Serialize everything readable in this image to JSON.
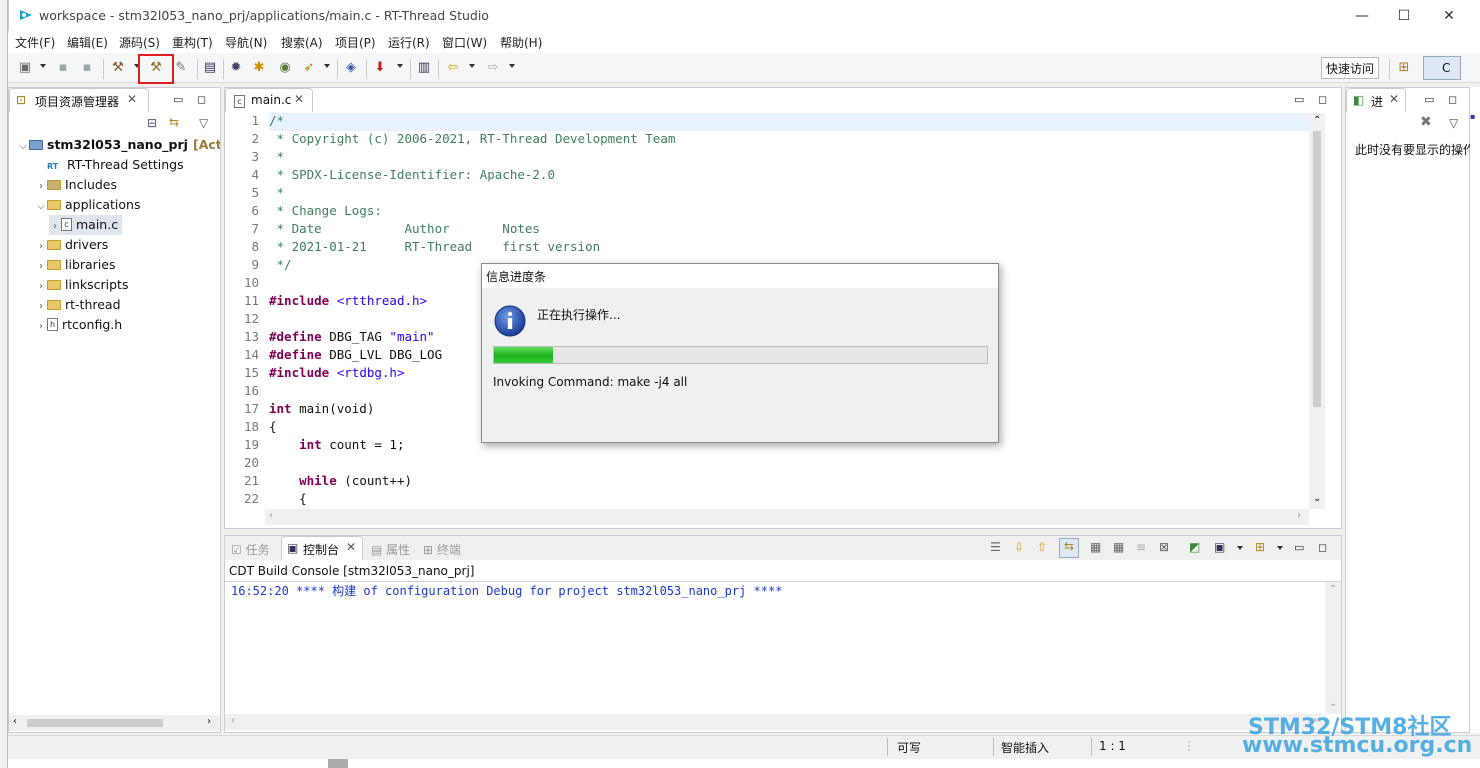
{
  "window": {
    "title": "workspace - stm32l053_nano_prj/applications/main.c - RT-Thread Studio",
    "minimize": "—",
    "maximize": "☐",
    "close": "✕"
  },
  "menu": [
    "文件(F)",
    "编辑(E)",
    "源码(S)",
    "重构(T)",
    "导航(N)",
    "搜索(A)",
    "项目(P)",
    "运行(R)",
    "窗口(W)",
    "帮助(H)"
  ],
  "toolbar": {
    "quick_access": "快速访问",
    "perspective_label": "C",
    "highlight_color": "#e02020"
  },
  "project_explorer": {
    "tab_label": "项目资源管理器",
    "root": "stm32l053_nano_prj",
    "root_badge": "[Act",
    "items": [
      {
        "label": "RT-Thread Settings",
        "icon": "rt-settings-icon"
      },
      {
        "label": "Includes",
        "icon": "includes-icon"
      },
      {
        "label": "applications",
        "icon": "folder-icon"
      },
      {
        "label": "main.c",
        "icon": "c-file-icon"
      },
      {
        "label": "drivers",
        "icon": "folder-icon"
      },
      {
        "label": "libraries",
        "icon": "folder-icon"
      },
      {
        "label": "linkscripts",
        "icon": "folder-icon"
      },
      {
        "label": "rt-thread",
        "icon": "folder-icon"
      },
      {
        "label": "rtconfig.h",
        "icon": "h-file-icon"
      }
    ]
  },
  "editor": {
    "tab_label": "main.c",
    "lines": [
      {
        "n": "1",
        "text": "/*"
      },
      {
        "n": "2",
        "text": " * Copyright (c) 2006-2021, RT-Thread Development Team"
      },
      {
        "n": "3",
        "text": " *"
      },
      {
        "n": "4",
        "text": " * SPDX-License-Identifier: Apache-2.0"
      },
      {
        "n": "5",
        "text": " *"
      },
      {
        "n": "6",
        "text": " * Change Logs:"
      },
      {
        "n": "7",
        "text": " * Date           Author       Notes"
      },
      {
        "n": "8",
        "text": " * 2021-01-21     RT-Thread    first version"
      },
      {
        "n": "9",
        "text": " */"
      },
      {
        "n": "10",
        "text": ""
      },
      {
        "n": "11",
        "kw": "#include",
        "rest": " <rtthread.h>"
      },
      {
        "n": "12",
        "text": ""
      },
      {
        "n": "13",
        "kw": "#define",
        "rest": " DBG_TAG ",
        "str": "\"main\""
      },
      {
        "n": "14",
        "kw": "#define",
        "rest": " DBG_LVL DBG_LOG"
      },
      {
        "n": "15",
        "kw": "#include",
        "rest": " <rtdbg.h>"
      },
      {
        "n": "16",
        "text": ""
      },
      {
        "n": "17",
        "kw": "int",
        "rest": " main(void)"
      },
      {
        "n": "18",
        "text": "{"
      },
      {
        "n": "19",
        "indent": "    ",
        "kw": "int",
        "rest": " count = 1;"
      },
      {
        "n": "20",
        "text": ""
      },
      {
        "n": "21",
        "indent": "    ",
        "kw": "while",
        "rest": " (count++)"
      },
      {
        "n": "22",
        "text": "    {"
      }
    ]
  },
  "outline": {
    "tab_label": "进",
    "empty_text": "此时没有要显示的操作"
  },
  "console": {
    "tabs": [
      "任务",
      "控制台",
      "属性",
      "终端"
    ],
    "header": "CDT Build Console [stm32l053_nano_prj]",
    "output": "16:52:20 **** 构建 of configuration Debug for project stm32l053_nano_prj ****"
  },
  "dialog": {
    "title": "信息进度条",
    "message": "正在执行操作...",
    "progress": 0.12,
    "detail": "Invoking Command: make -j4 all"
  },
  "status": {
    "writable": "可写",
    "insert_mode": "智能插入",
    "position": "1 : 1"
  },
  "watermark": {
    "line1": "STM32/STM8社区",
    "line2": "www.stmcu.org.cn"
  }
}
